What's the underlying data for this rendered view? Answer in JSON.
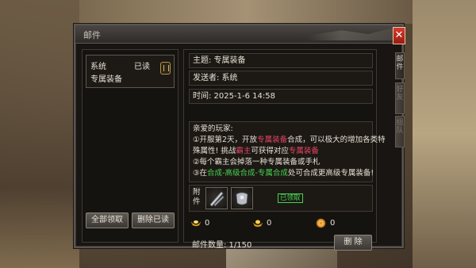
{
  "window": {
    "title": "邮件"
  },
  "side_tabs": [
    "邮件",
    "好友",
    "组队"
  ],
  "mail_list": {
    "items": [
      {
        "sender": "系统",
        "status": "已读",
        "subject": "专属装备"
      }
    ],
    "claim_all_label": "全部领取",
    "delete_read_label": "删除已读"
  },
  "detail": {
    "subject": "主题: 专属装备",
    "sender": "发送者: 系统",
    "time": "时间: 2025-1-6 14:58",
    "greeting": "亲爱的玩家:",
    "line1_a": "①开服第2天，开放",
    "line1_hl": "专属装备",
    "line1_b": "合成，可以极大的增加各类特",
    "line2_a": "殊属性! 挑战",
    "line2_hl1": "霸主",
    "line2_b": "可获得对应",
    "line2_hl2": "专属装备",
    "line3": "②每个霸主会掉落一种专属装备或手札",
    "line4_a": "③在",
    "line4_hl": "合成-高级合成-专属合成",
    "line4_b": "处可合成更高级专属装备!",
    "attachment_label": "附件",
    "claimed_label": "已领取",
    "currencies": [
      {
        "icon": "gold-ingot-icon",
        "value": "0"
      },
      {
        "icon": "bound-gold-ingot-icon",
        "value": "0"
      },
      {
        "icon": "coin-icon",
        "value": "0"
      }
    ],
    "mail_count": "邮件数量: 1/150",
    "delete_label": "删 除"
  },
  "colors": {
    "highlight_red": "#e54563",
    "highlight_green": "#47d24f"
  }
}
